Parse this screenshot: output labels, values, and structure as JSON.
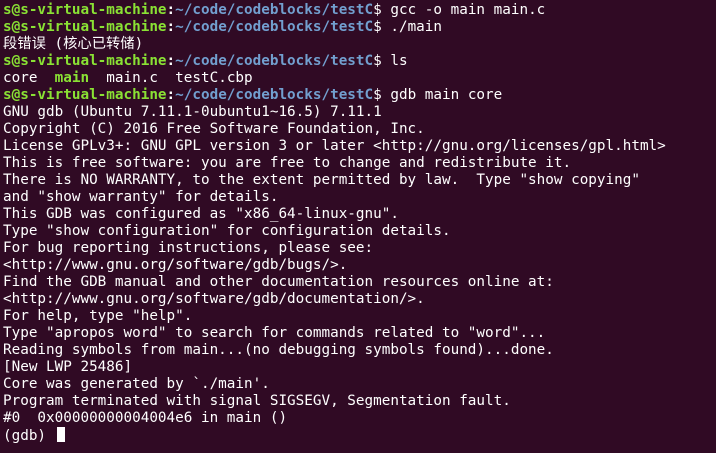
{
  "prompt": {
    "user_host": "s@s-virtual-machine",
    "separator": ":",
    "path": "~/code/codeblocks/testC",
    "dollar": "$ "
  },
  "session": {
    "cmd_gcc": "gcc -o main main.c",
    "cmd_run": "./main",
    "out_segfault": "段错误 (核心已转储)",
    "cmd_ls": "ls",
    "ls_core": "core  ",
    "ls_main": "main",
    "ls_rest": "  main.c  testC.cbp",
    "cmd_gdb": "gdb main core",
    "gdb_lines": [
      "GNU gdb (Ubuntu 7.11.1-0ubuntu1~16.5) 7.11.1",
      "Copyright (C) 2016 Free Software Foundation, Inc.",
      "License GPLv3+: GNU GPL version 3 or later <http://gnu.org/licenses/gpl.html>",
      "This is free software: you are free to change and redistribute it.",
      "There is NO WARRANTY, to the extent permitted by law.  Type \"show copying\"",
      "and \"show warranty\" for details.",
      "This GDB was configured as \"x86_64-linux-gnu\".",
      "Type \"show configuration\" for configuration details.",
      "For bug reporting instructions, please see:",
      "<http://www.gnu.org/software/gdb/bugs/>.",
      "Find the GDB manual and other documentation resources online at:",
      "<http://www.gnu.org/software/gdb/documentation/>.",
      "For help, type \"help\".",
      "Type \"apropos word\" to search for commands related to \"word\"...",
      "Reading symbols from main...(no debugging symbols found)...done.",
      "[New LWP 25486]",
      "Core was generated by `./main'.",
      "Program terminated with signal SIGSEGV, Segmentation fault.",
      "#0  0x00000000004004e6 in main ()"
    ],
    "gdb_prompt": "(gdb) "
  },
  "colors": {
    "background": "#300a24",
    "prompt_user": "#8ae234",
    "prompt_path": "#729fcf",
    "text": "#ffffff",
    "executable": "#8ae234"
  }
}
